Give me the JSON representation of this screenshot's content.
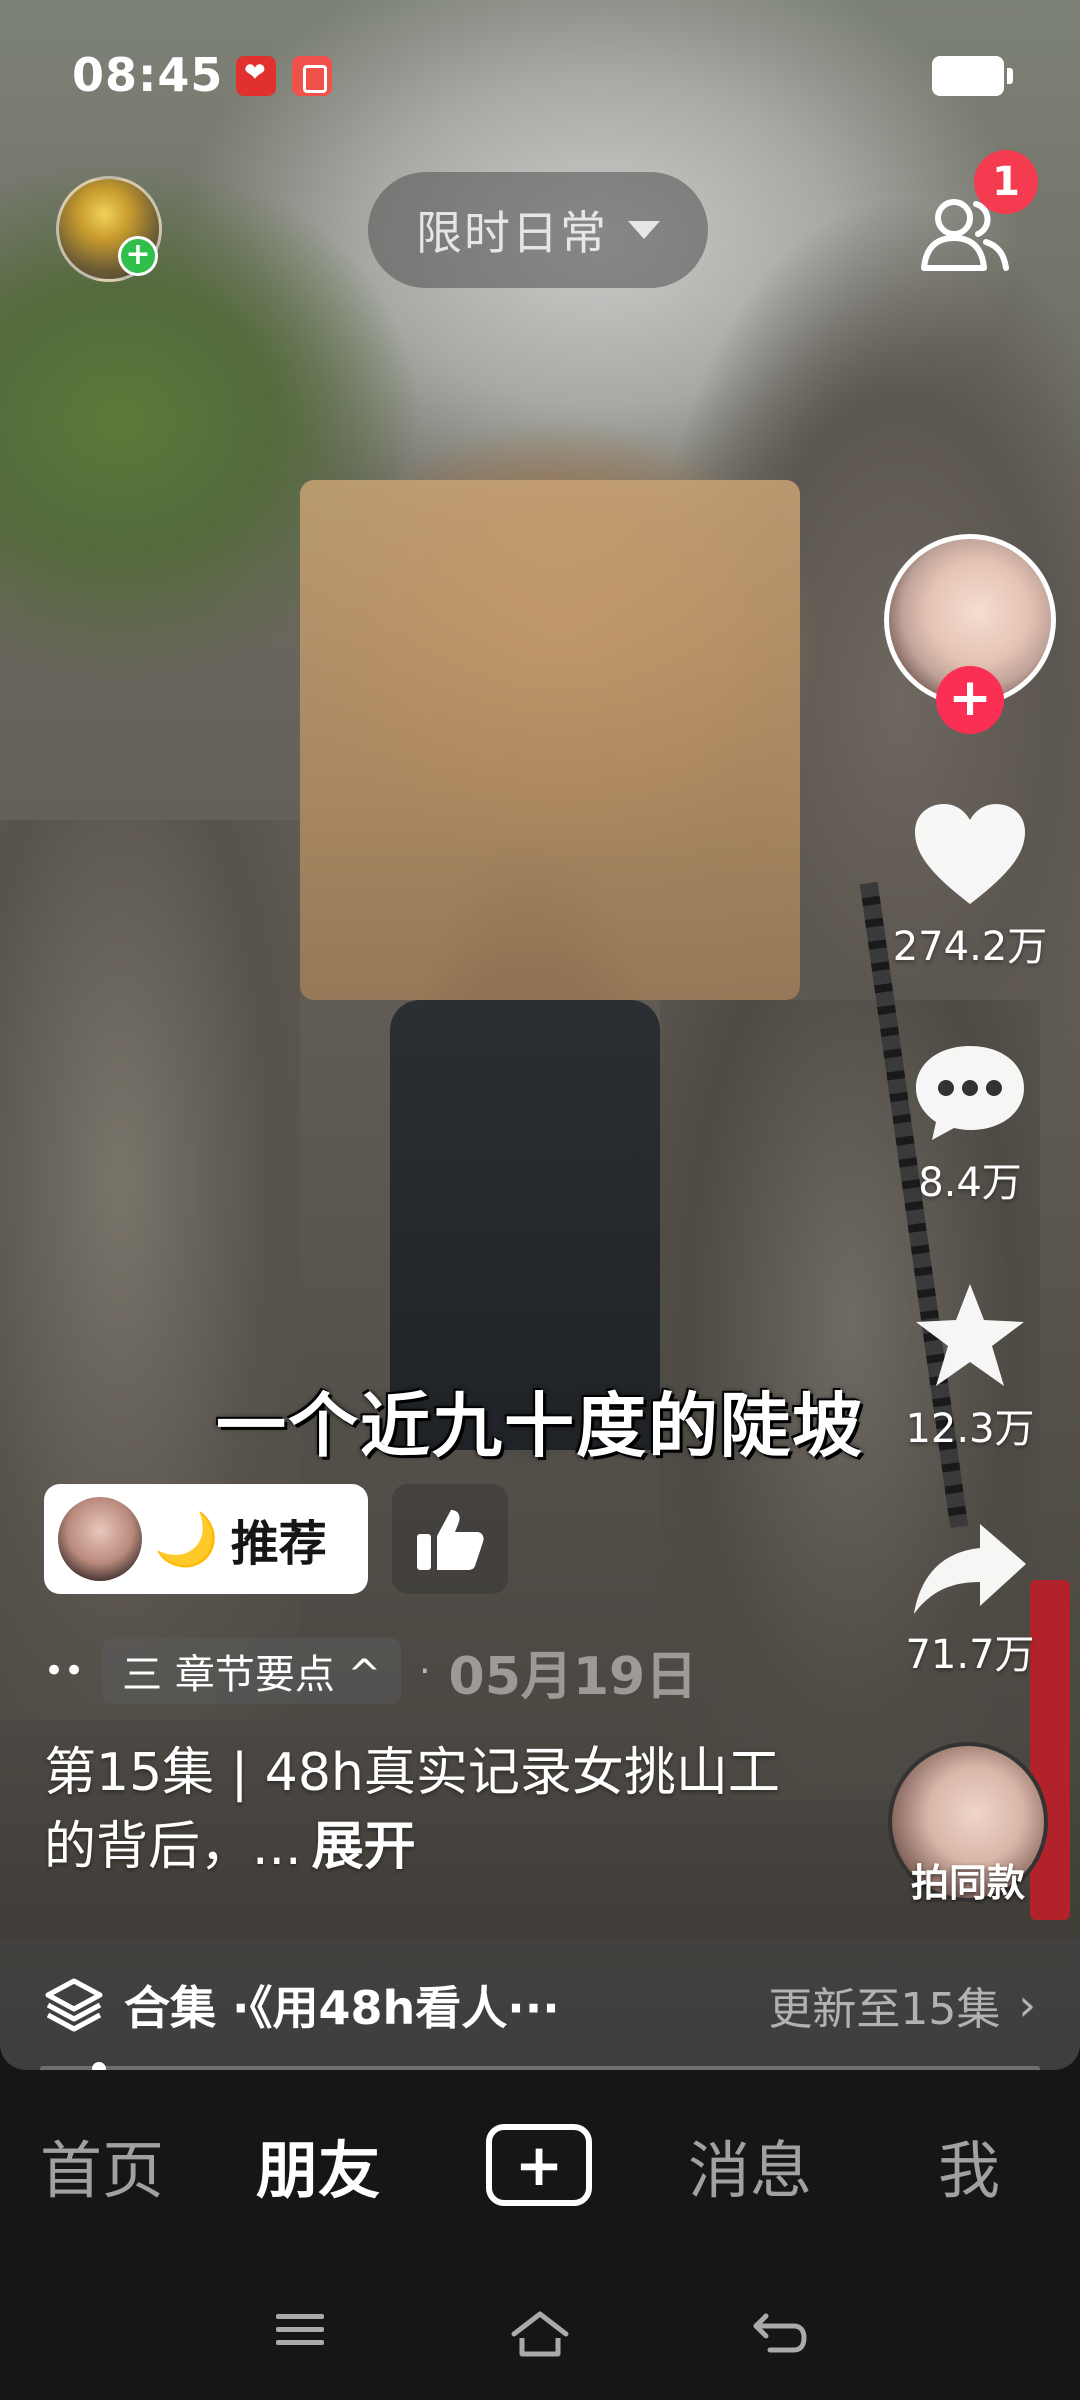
{
  "status_bar": {
    "time": "08:45"
  },
  "top": {
    "feed_selector": "限时日常",
    "friends_badge": "1"
  },
  "right_rail": {
    "like_count": "274.2万",
    "comment_count": "8.4万",
    "favorite_count": "12.3万",
    "share_count": "71.7万",
    "same_style_label": "拍同款"
  },
  "video": {
    "subtitle": "一个近九十度的陡坡",
    "recommend_label": "推荐",
    "chapter_label": "三 章节要点 ^",
    "date": "05月19日",
    "description": "第15集 | 48h真实记录女挑山工的背后，...",
    "expand_label": "展开"
  },
  "collection": {
    "title": "合集 ·《用48h看人···",
    "update": "更新至15集"
  },
  "tabs": [
    {
      "label": "首页",
      "active": false
    },
    {
      "label": "朋友",
      "active": true
    },
    {
      "label": "消息",
      "active": false
    },
    {
      "label": "我",
      "active": false
    }
  ],
  "colors": {
    "like_accent": "#fb2e54",
    "badge": "#f43b4f",
    "tab_bg": "#161616"
  }
}
